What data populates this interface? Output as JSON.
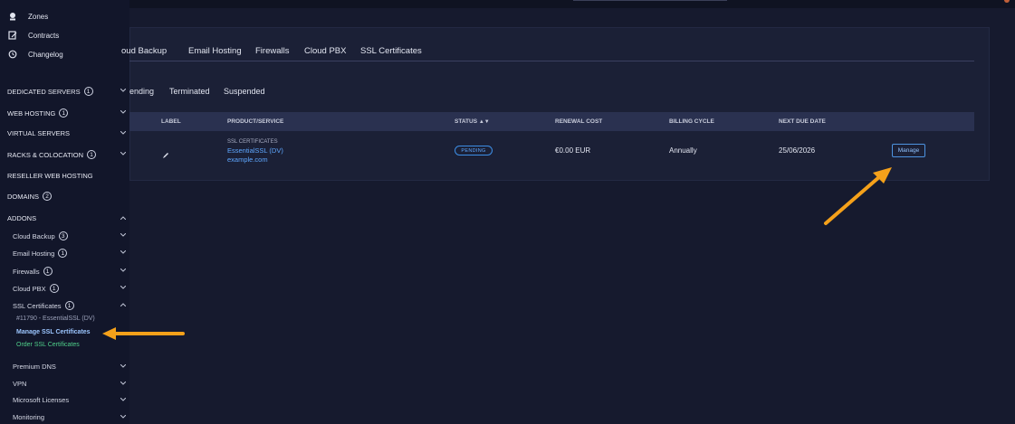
{
  "sidebar": {
    "top_items": [
      {
        "label": "Zones",
        "icon": "zones-icon"
      },
      {
        "label": "Contracts",
        "icon": "contracts-icon"
      },
      {
        "label": "Changelog",
        "icon": "changelog-icon"
      }
    ],
    "sections": [
      {
        "label": "DEDICATED SERVERS",
        "badge": "1"
      },
      {
        "label": "WEB HOSTING",
        "badge": "1"
      },
      {
        "label": "VIRTUAL SERVERS",
        "badge": ""
      },
      {
        "label": "RACKS & COLOCATION",
        "badge": "1"
      },
      {
        "label": "RESELLER WEB HOSTING",
        "badge": ""
      },
      {
        "label": "DOMAINS",
        "badge": "2"
      },
      {
        "label": "ADDONS",
        "badge": ""
      }
    ],
    "addons": [
      {
        "label": "Cloud Backup",
        "badge": "3"
      },
      {
        "label": "Email Hosting",
        "badge": "1"
      },
      {
        "label": "Firewalls",
        "badge": "1"
      },
      {
        "label": "Cloud PBX",
        "badge": "1"
      },
      {
        "label": "SSL Certificates",
        "badge": "1"
      }
    ],
    "ssl_detail": "#11790 - EssentialSSL (DV)",
    "ssl_manage": "Manage SSL Certificates",
    "ssl_order": "Order SSL Certificates",
    "more_addons": [
      {
        "label": "Premium DNS"
      },
      {
        "label": "VPN"
      },
      {
        "label": "Microsoft Licenses"
      },
      {
        "label": "Monitoring"
      }
    ]
  },
  "tabs": [
    "oud Backup",
    "Email Hosting",
    "Firewalls",
    "Cloud PBX",
    "SSL Certificates"
  ],
  "filters": [
    "ending",
    "Terminated",
    "Suspended"
  ],
  "table": {
    "headers": {
      "label": "LABEL",
      "product": "PRODUCT/SERVICE",
      "status": "STATUS",
      "renewal": "RENEWAL COST",
      "billing": "BILLING CYCLE",
      "due": "NEXT DUE DATE"
    },
    "row": {
      "product_category": "SSL CERTIFICATES",
      "product_name": "EssentialSSL (DV)",
      "product_domain": "example.com",
      "status": "PENDING",
      "renewal": "€0.00 EUR",
      "billing": "Annually",
      "due": "25/06/2026",
      "action": "Manage"
    }
  },
  "colors": {
    "accent": "#5ea7ff",
    "annotation_arrow": "#f5a11a",
    "order_link": "#4fd08a"
  }
}
